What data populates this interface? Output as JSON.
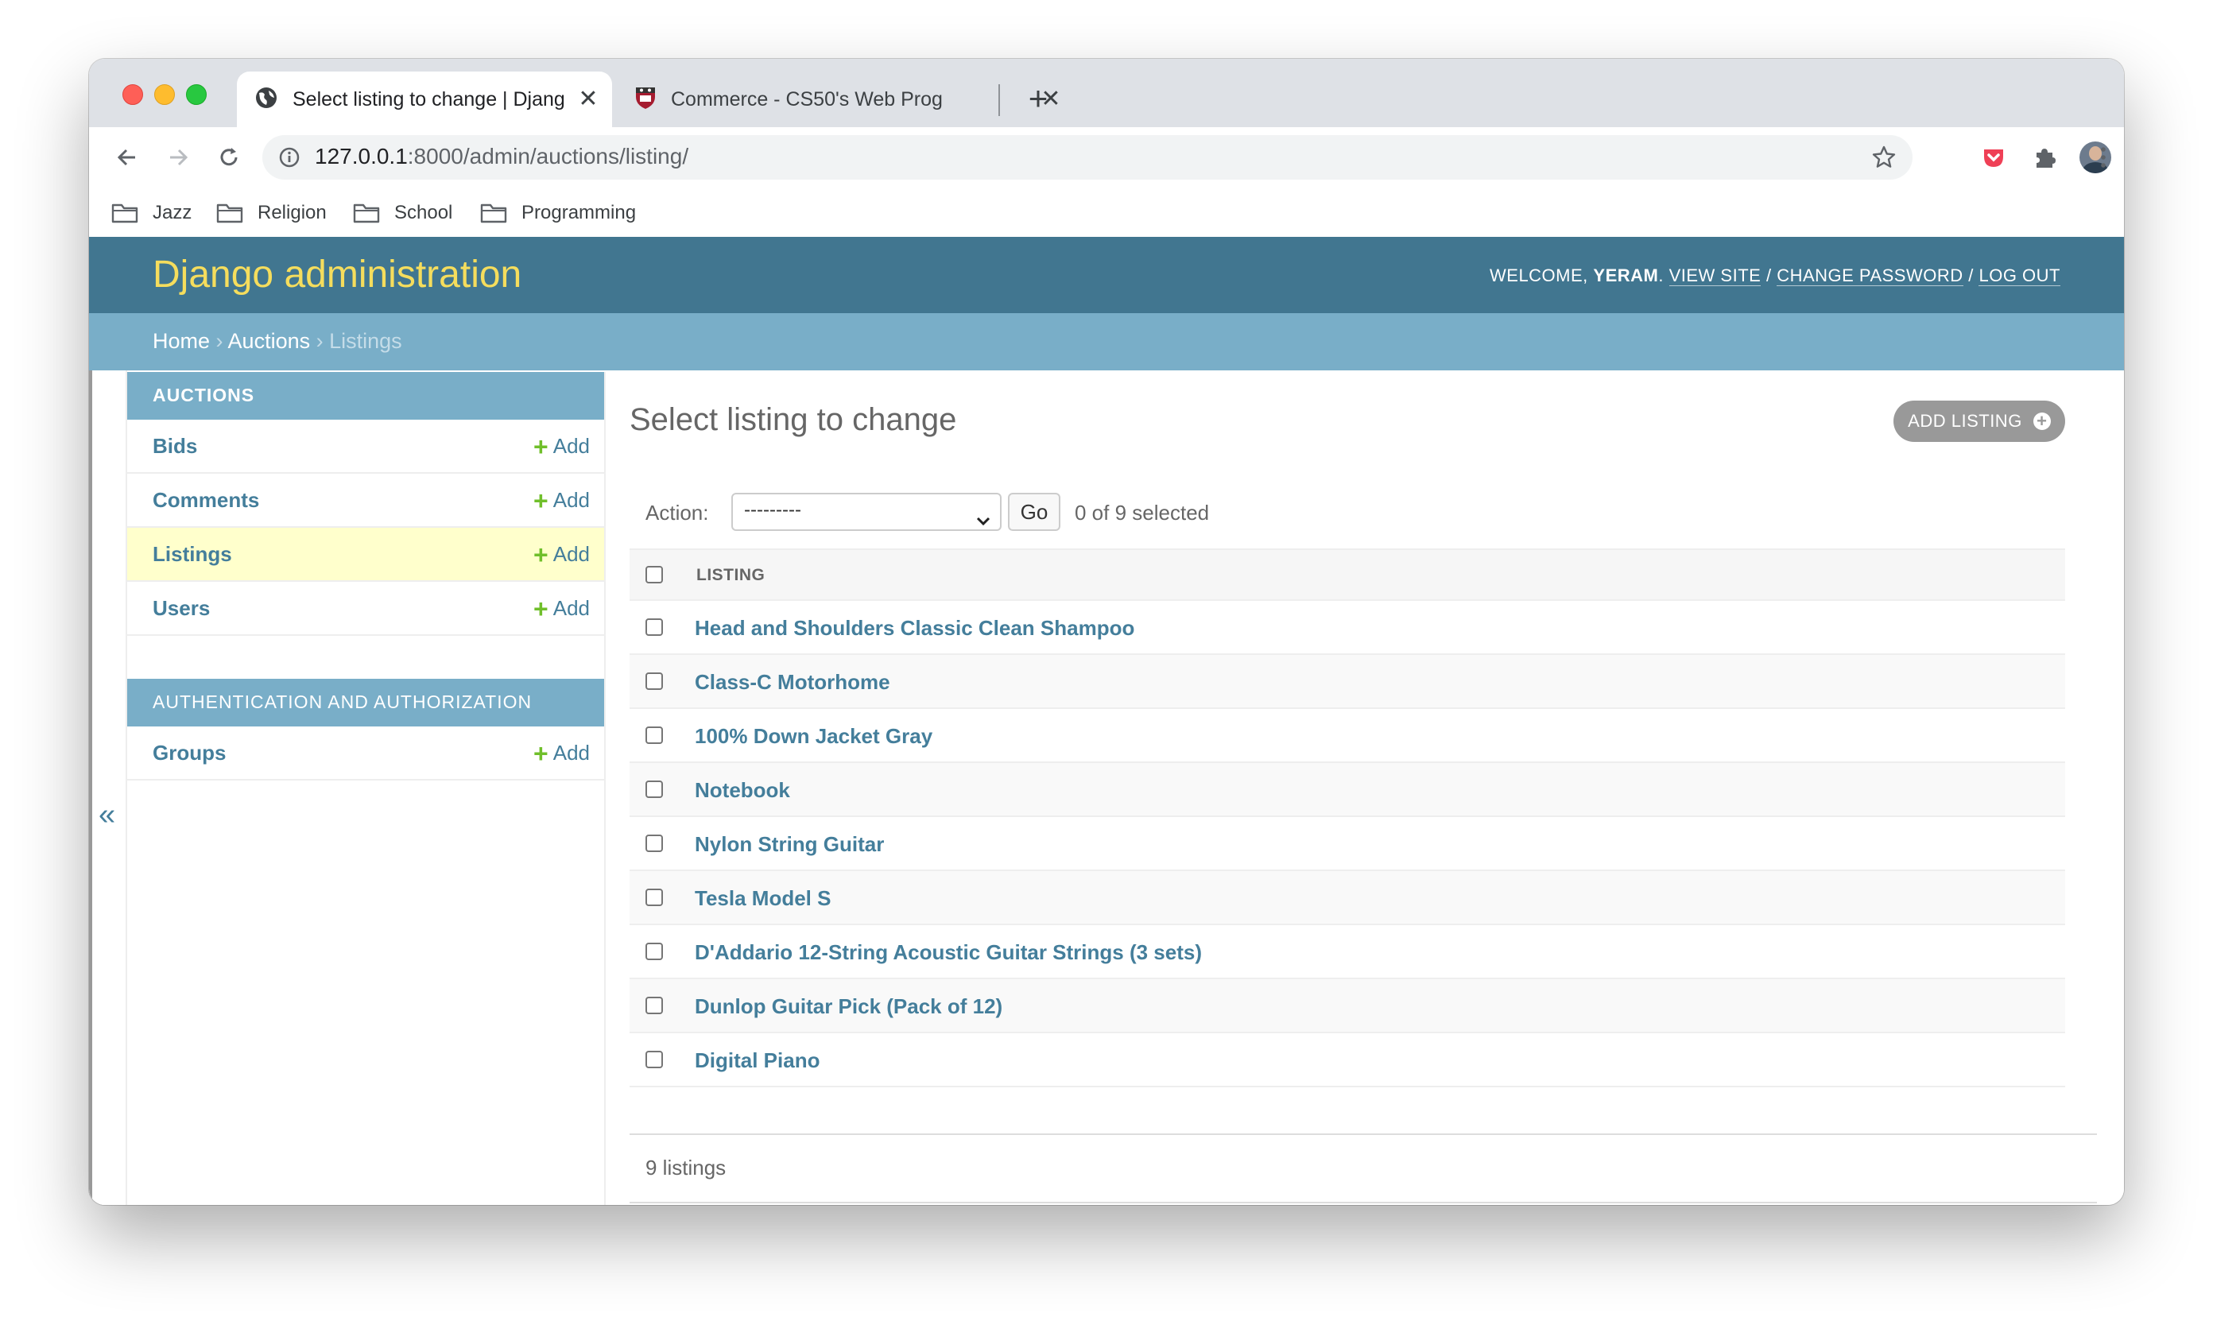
{
  "browser": {
    "tabs": [
      {
        "title": "Select listing to change | Djang",
        "active": true,
        "icon": "globe-icon"
      },
      {
        "title": "Commerce - CS50's Web Prog",
        "active": false,
        "icon": "shield-crest-icon"
      }
    ],
    "url": {
      "host": "127.0.0.1",
      "rest": ":8000/admin/auctions/listing/"
    },
    "bookmarks": [
      "Jazz",
      "Religion",
      "School",
      "Programming"
    ]
  },
  "admin": {
    "site_name": "Django administration",
    "user_tools": {
      "welcome": "WELCOME, ",
      "username": "YERAM",
      "view_site": "VIEW SITE",
      "change_password": "CHANGE PASSWORD",
      "log_out": "LOG OUT",
      "separator": " / "
    },
    "breadcrumbs": {
      "home": "Home",
      "app": "Auctions",
      "current": "Listings",
      "sep": " › "
    },
    "collapse_icon": "«",
    "sidebar": {
      "auctions": {
        "caption": "AUCTIONS",
        "models": [
          {
            "name": "Bids",
            "add": "Add"
          },
          {
            "name": "Comments",
            "add": "Add"
          },
          {
            "name": "Listings",
            "add": "Add",
            "current": true
          },
          {
            "name": "Users",
            "add": "Add"
          }
        ]
      },
      "auth": {
        "caption": "AUTHENTICATION AND AUTHORIZATION",
        "models": [
          {
            "name": "Groups",
            "add": "Add"
          }
        ]
      }
    },
    "content": {
      "title": "Select listing to change",
      "add_button": "ADD LISTING",
      "action": {
        "label": "Action:",
        "selected": "---------",
        "go": "Go",
        "counter": "0 of 9 selected"
      },
      "column_header": "LISTING",
      "rows": [
        "Head and Shoulders Classic Clean Shampoo",
        "Class-C Motorhome",
        "100% Down Jacket Gray",
        "Notebook",
        "Nylon String Guitar",
        "Tesla Model S",
        "D'Addario 12-String Acoustic Guitar Strings (3 sets)",
        "Dunlop Guitar Pick (Pack of 12)",
        "Digital Piano"
      ],
      "paginator": "9 listings"
    }
  },
  "colors": {
    "header": "#417690",
    "breadcrumbs": "#79aec8",
    "site_name": "#f5dd5d",
    "link": "#447e9b",
    "add_plus": "#70bf2b",
    "current_row": "#ffffcc"
  }
}
